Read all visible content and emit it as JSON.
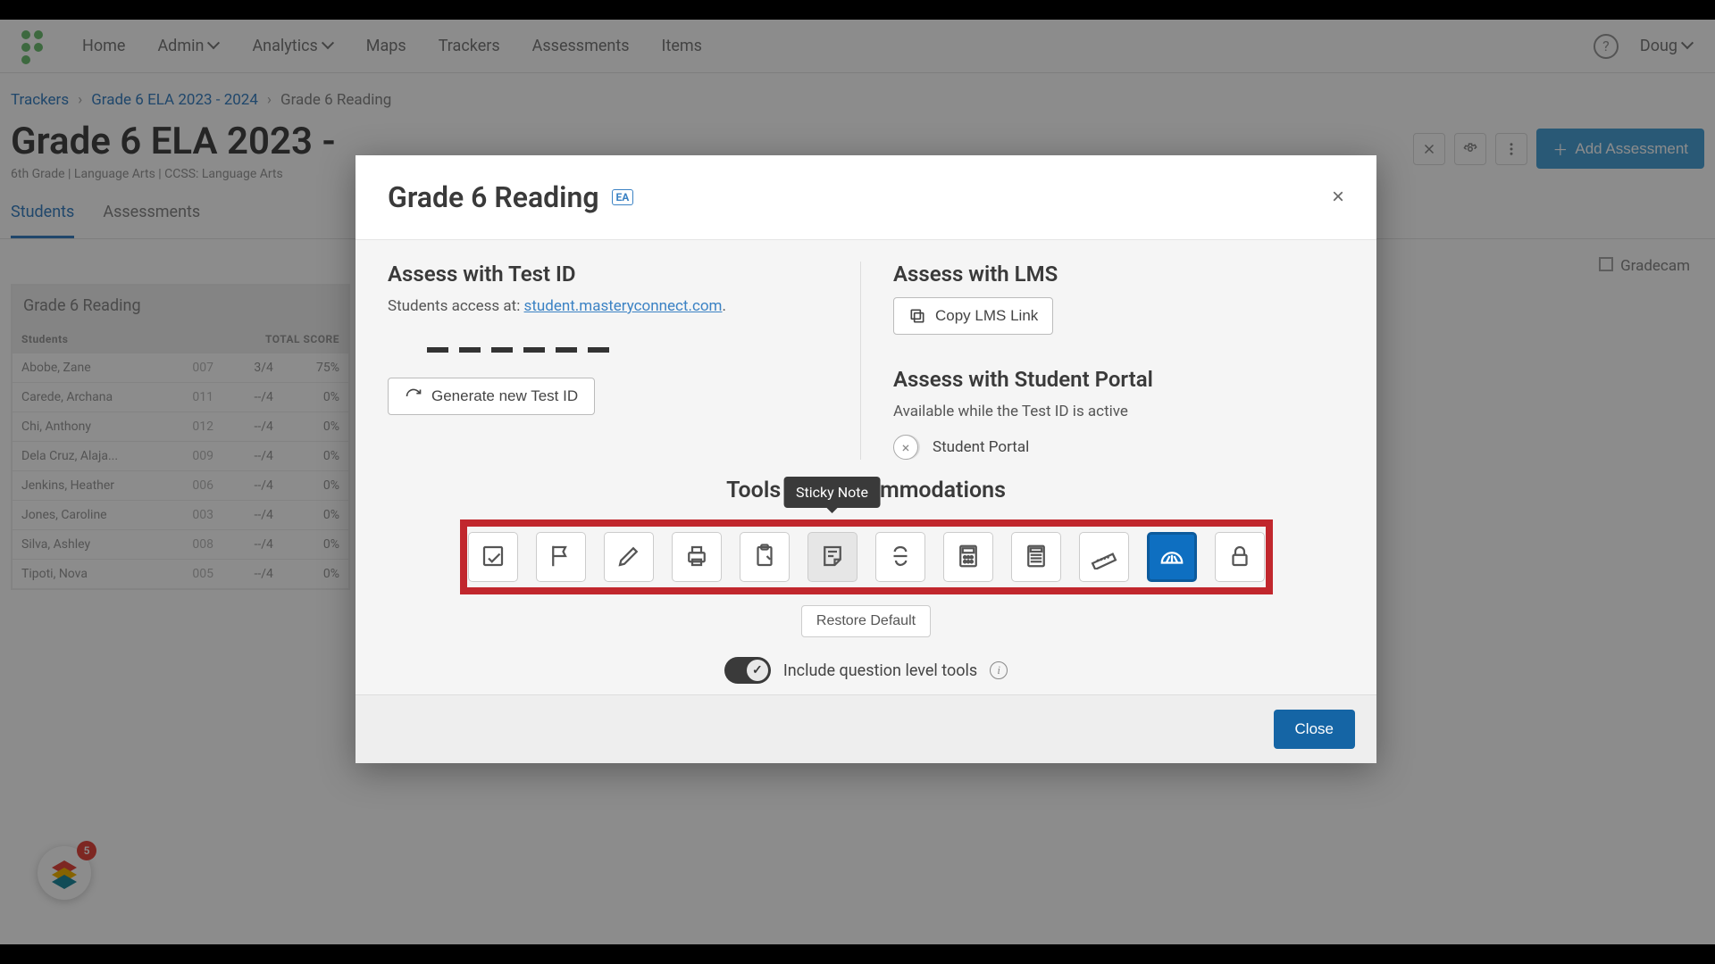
{
  "nav": {
    "links": [
      "Home",
      "Admin",
      "Analytics",
      "Maps",
      "Trackers",
      "Assessments",
      "Items"
    ],
    "user": "Doug"
  },
  "breadcrumb": {
    "items": [
      "Trackers",
      "Grade 6 ELA 2023 - 2024",
      "Grade 6 Reading"
    ]
  },
  "page": {
    "title": "Grade 6 ELA 2023 -",
    "meta": "6th Grade  |  Language Arts  |  CCSS: Language Arts",
    "add_button": "Add Assessment",
    "gradecam": "Gradecam"
  },
  "tabs": {
    "items": [
      "Students",
      "Assessments"
    ],
    "active": 0
  },
  "table": {
    "title": "Grade 6 Reading",
    "headers": {
      "name": "Students",
      "score": "TOTAL SCORE"
    },
    "rows": [
      {
        "name": "Abobe, Zane",
        "id": "007",
        "score": "3/4",
        "pct": "75%"
      },
      {
        "name": "Carede, Archana",
        "id": "011",
        "score": "--/4",
        "pct": "0%"
      },
      {
        "name": "Chi, Anthony",
        "id": "012",
        "score": "--/4",
        "pct": "0%"
      },
      {
        "name": "Dela Cruz, Alaja...",
        "id": "009",
        "score": "--/4",
        "pct": "0%"
      },
      {
        "name": "Jenkins, Heather",
        "id": "006",
        "score": "--/4",
        "pct": "0%"
      },
      {
        "name": "Jones, Caroline",
        "id": "003",
        "score": "--/4",
        "pct": "0%"
      },
      {
        "name": "Silva, Ashley",
        "id": "008",
        "score": "--/4",
        "pct": "0%"
      },
      {
        "name": "Tipoti, Nova",
        "id": "005",
        "score": "--/4",
        "pct": "0%"
      }
    ]
  },
  "widget_badge": "5",
  "modal": {
    "title": "Grade 6 Reading",
    "ea_badge": "EA",
    "assess_testid": {
      "heading": "Assess with Test ID",
      "text_prefix": "Students access at: ",
      "link": "student.masteryconnect.com",
      "generate": "Generate new Test ID"
    },
    "assess_lms": {
      "heading": "Assess with LMS",
      "copy": "Copy LMS Link"
    },
    "assess_portal": {
      "heading": "Assess with Student Portal",
      "text": "Available while the Test ID is active",
      "label": "Student Portal"
    },
    "tools_heading": "Tools and Accommodations",
    "tooltip": "Sticky Note",
    "tools": [
      "notepad",
      "flag",
      "pencil",
      "printer",
      "clipboard",
      "sticky-note",
      "strikethrough",
      "calculator-basic",
      "calculator-sci",
      "ruler",
      "protractor",
      "lock"
    ],
    "active_tool": 10,
    "hovered_tool": 5,
    "restore": "Restore Default",
    "include_label": "Include question level tools",
    "close": "Close"
  }
}
